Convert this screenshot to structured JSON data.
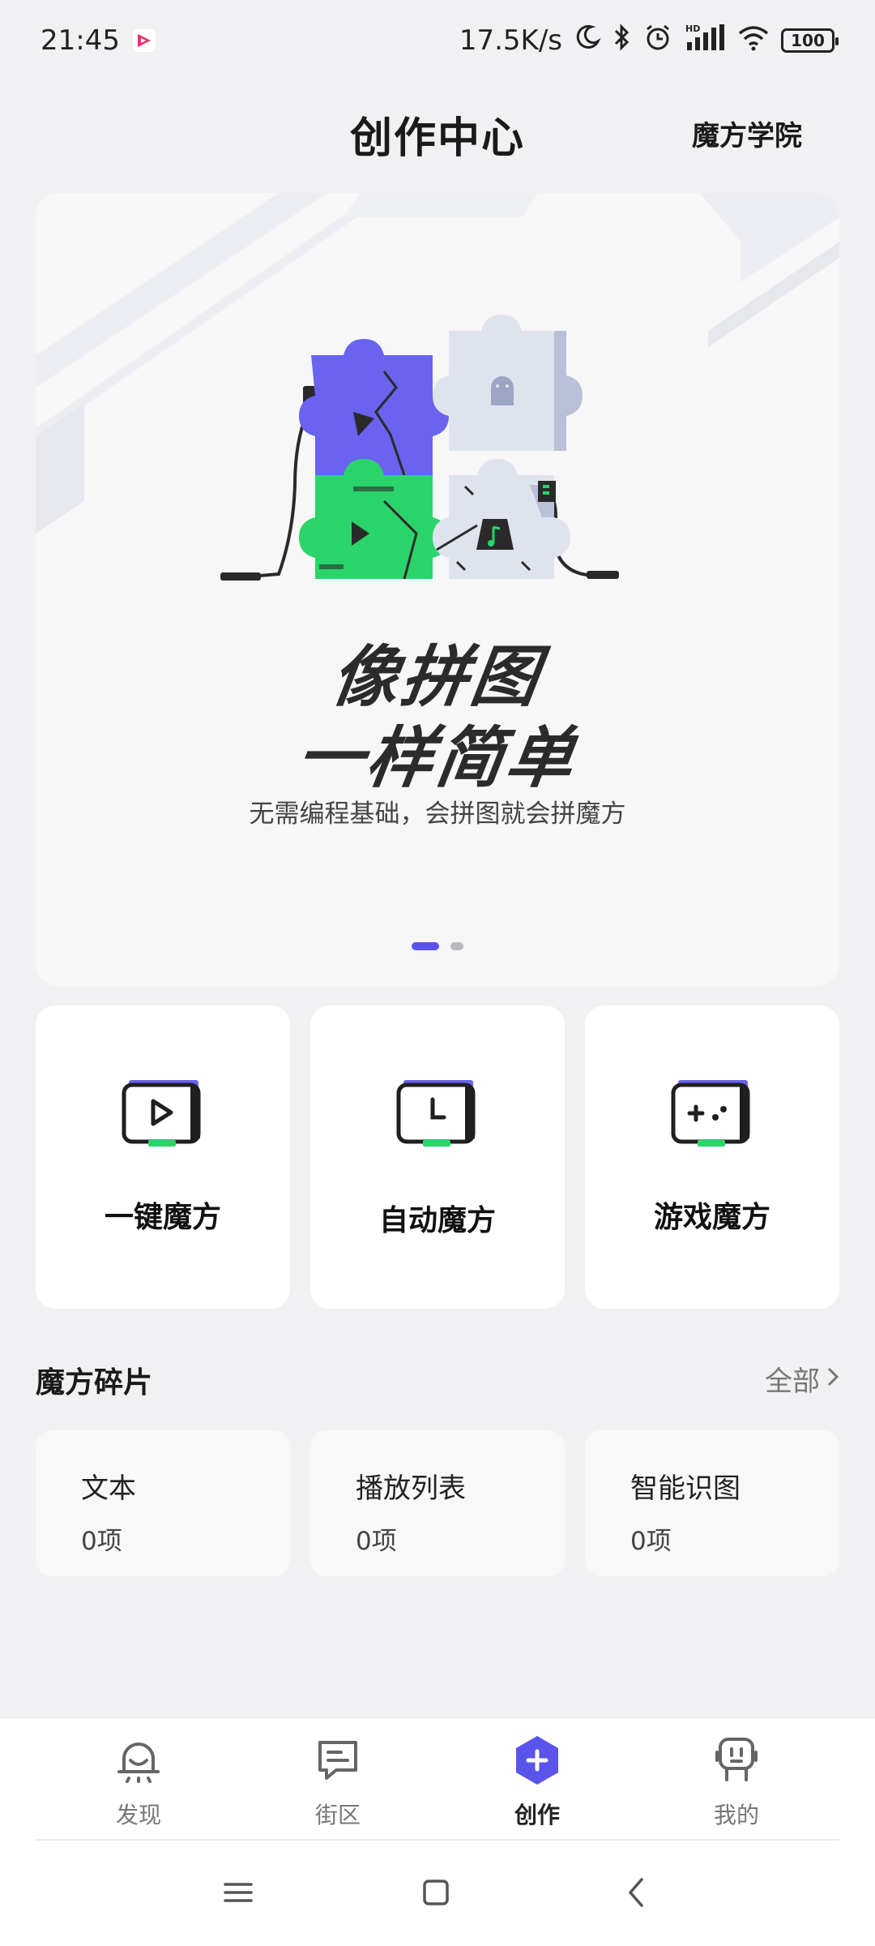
{
  "status": {
    "time": "21:45",
    "speed": "17.5K/s",
    "network": "HD",
    "battery": "100",
    "icons": [
      "app-notification-icon",
      "moon-icon",
      "bluetooth-icon",
      "alarm-icon",
      "signal-icon",
      "wifi-icon",
      "battery-icon"
    ]
  },
  "header": {
    "title": "创作中心",
    "academy": "魔方学院"
  },
  "banner": {
    "slogan_line1": "像拼图",
    "slogan_line2": "一样简单",
    "subtitle": "无需编程基础，会拼图就会拼魔方",
    "pages": 2,
    "active_page": 1,
    "colors": {
      "purple": "#6a63f0",
      "green": "#2bd46a",
      "light": "#dfe3ee"
    }
  },
  "modes": [
    {
      "label": "一键魔方",
      "icon": "play-icon"
    },
    {
      "label": "自动魔方",
      "icon": "clock-icon"
    },
    {
      "label": "游戏魔方",
      "icon": "gamepad-icon"
    }
  ],
  "fragments": {
    "title": "魔方碎片",
    "see_all": "全部",
    "items": [
      {
        "name": "文本",
        "count": "0项"
      },
      {
        "name": "播放列表",
        "count": "0项"
      },
      {
        "name": "智能识图",
        "count": "0项"
      }
    ]
  },
  "tabs": [
    {
      "label": "发现",
      "icon": "discover-icon",
      "active": false
    },
    {
      "label": "街区",
      "icon": "chat-icon",
      "active": false
    },
    {
      "label": "创作",
      "icon": "create-plus-icon",
      "active": true
    },
    {
      "label": "我的",
      "icon": "profile-icon",
      "active": false
    }
  ],
  "accent": "#5b54ea"
}
